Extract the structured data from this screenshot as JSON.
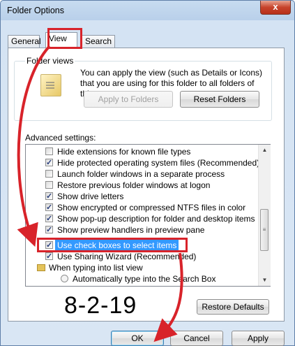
{
  "window": {
    "title": "Folder Options",
    "close_glyph": "x"
  },
  "tabs": [
    {
      "label": "General",
      "active": false
    },
    {
      "label": "View",
      "active": true
    },
    {
      "label": "Search",
      "active": false
    }
  ],
  "folder_views": {
    "label": "Folder views",
    "description": "You can apply the view (such as Details or Icons) that you are using for this folder to all folders of this type.",
    "apply_label": "Apply to Folders",
    "reset_label": "Reset Folders",
    "icon": "folder-views-icon"
  },
  "advanced": {
    "label": "Advanced settings:",
    "items": [
      {
        "label": "Hide extensions for known file types",
        "type": "checkbox",
        "checked": false
      },
      {
        "label": "Hide protected operating system files (Recommended)",
        "type": "checkbox",
        "checked": true
      },
      {
        "label": "Launch folder windows in a separate process",
        "type": "checkbox",
        "checked": false
      },
      {
        "label": "Restore previous folder windows at logon",
        "type": "checkbox",
        "checked": false
      },
      {
        "label": "Show drive letters",
        "type": "checkbox",
        "checked": true
      },
      {
        "label": "Show encrypted or compressed NTFS files in color",
        "type": "checkbox",
        "checked": true
      },
      {
        "label": "Show pop-up description for folder and desktop items",
        "type": "checkbox",
        "checked": true
      },
      {
        "label": "Show preview handlers in preview pane",
        "type": "checkbox",
        "checked": true
      },
      {
        "label": "Use check boxes to select items",
        "type": "checkbox",
        "checked": true,
        "selected": true
      },
      {
        "label": "Use Sharing Wizard (Recommended)",
        "type": "checkbox",
        "checked": true
      },
      {
        "label": "When typing into list view",
        "type": "folder"
      },
      {
        "label": "Automatically type into the Search Box",
        "type": "radio",
        "checked": false
      }
    ]
  },
  "buttons": {
    "restore_defaults": "Restore Defaults",
    "ok": "OK",
    "cancel": "Cancel",
    "apply": "Apply"
  },
  "annotation": {
    "date_text": "8-2-19",
    "color": "#d8232a"
  }
}
